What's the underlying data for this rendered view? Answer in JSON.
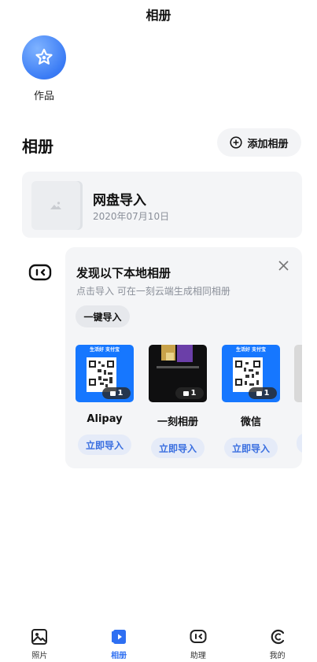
{
  "header": {
    "title": "相册"
  },
  "works": {
    "label": "作品",
    "icon": "star-badge-icon"
  },
  "albums": {
    "title": "相册",
    "add_button_label": "添加相册",
    "items": [
      {
        "name": "网盘导入",
        "date": "2020年07月10日"
      }
    ]
  },
  "discover": {
    "title": "发现以下本地相册",
    "subtitle": "点击导入 可在一刻云端生成相同相册",
    "one_click_label": "一键导入",
    "sources": [
      {
        "name": "Alipay",
        "count": "1",
        "import_label": "立即导入",
        "thumb_caption": "生活好 支付宝"
      },
      {
        "name": "一刻相册",
        "count": "1",
        "import_label": "立即导入",
        "thumb_caption": ""
      },
      {
        "name": "微信",
        "count": "1",
        "import_label": "立即导入",
        "thumb_caption": "生活好 支付宝"
      }
    ]
  },
  "bottom_nav": {
    "items": [
      {
        "label": "照片",
        "icon": "photo-icon",
        "active": false
      },
      {
        "label": "相册",
        "icon": "album-icon",
        "active": true
      },
      {
        "label": "助理",
        "icon": "assistant-icon",
        "active": false
      },
      {
        "label": "我的",
        "icon": "profile-icon",
        "active": false
      }
    ]
  },
  "colors": {
    "accent": "#2e6ff2",
    "works_icon": "#3b7cf5",
    "import_button_bg": "#e5ebf8",
    "card_bg": "#f4f5f7"
  }
}
